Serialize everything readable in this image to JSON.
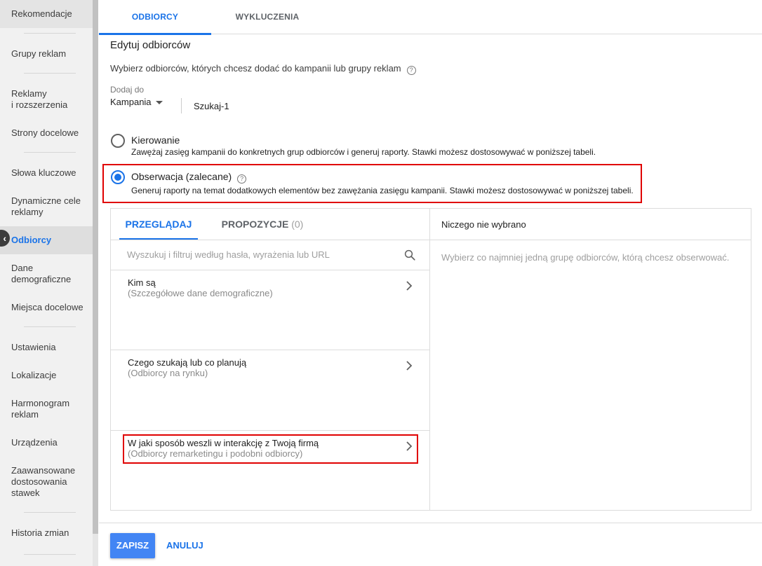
{
  "sidebar": {
    "items": [
      {
        "label": "Rekomendacje",
        "active": false
      },
      {
        "label": "Grupy reklam",
        "active": false
      },
      {
        "label": "Reklamy\ni rozszerzenia",
        "active": false
      },
      {
        "label": "Strony docelowe",
        "active": false
      },
      {
        "label": "Słowa kluczowe",
        "active": false
      },
      {
        "label": "Dynamiczne cele\nreklamy",
        "active": false
      },
      {
        "label": "Odbiorcy",
        "active": true
      },
      {
        "label": "Dane\ndemograficzne",
        "active": false
      },
      {
        "label": "Miejsca docelowe",
        "active": false
      },
      {
        "label": "Ustawienia",
        "active": false
      },
      {
        "label": "Lokalizacje",
        "active": false
      },
      {
        "label": "Harmonogram\nreklam",
        "active": false
      },
      {
        "label": "Urządzenia",
        "active": false
      },
      {
        "label": "Zaawansowane\ndostosowania\nstawek",
        "active": false
      },
      {
        "label": "Historia zmian",
        "active": false
      }
    ]
  },
  "top_tabs": [
    {
      "label": "ODBIORCY",
      "active": true
    },
    {
      "label": "WYKLUCZENIA",
      "active": false
    }
  ],
  "section_title": "Edytuj odbiorców",
  "instruction": "Wybierz odbiorców, których chcesz dodać do kampanii lub grupy reklam",
  "add_to": {
    "label": "Dodaj do",
    "selected": "Kampania",
    "campaign_name": "Szukaj-1"
  },
  "targeting_options": [
    {
      "title": "Kierowanie",
      "description": "Zawężaj zasięg kampanii do konkretnych grup odbiorców i generuj raporty. Stawki możesz dostosowywać w poniższej tabeli.",
      "selected": false
    },
    {
      "title": "Obserwacja (zalecane)",
      "description": "Generuj raporty na temat dodatkowych elementów bez zawężania zasięgu kampanii. Stawki możesz dostosowywać w poniższej tabeli.",
      "selected": true
    }
  ],
  "inner_tabs": [
    {
      "label": "PRZEGLĄDAJ",
      "count": "",
      "active": true
    },
    {
      "label": "PROPOZYCJE",
      "count": "(0)",
      "active": false
    }
  ],
  "search": {
    "placeholder": "Wyszukuj i filtruj według hasła, wyrażenia lub URL"
  },
  "categories": [
    {
      "title": "Kim są",
      "subtitle": "(Szczegółowe dane demograficzne)"
    },
    {
      "title": "Czego szukają lub co planują",
      "subtitle": "(Odbiorcy na rynku)"
    },
    {
      "title": "W jaki sposób weszli w interakcję z Twoją firmą",
      "subtitle": "(Odbiorcy remarketingu i podobni odbiorcy)"
    }
  ],
  "selection_panel": {
    "header": "Niczego nie wybrano",
    "hint": "Wybierz co najmniej jedną grupę odbiorców, którą chcesz obserwować."
  },
  "actions": {
    "save": "ZAPISZ",
    "cancel": "ANULUJ"
  },
  "colors": {
    "accent": "#1a73e8",
    "highlight": "#e00000",
    "save_button": "#4285f4"
  }
}
